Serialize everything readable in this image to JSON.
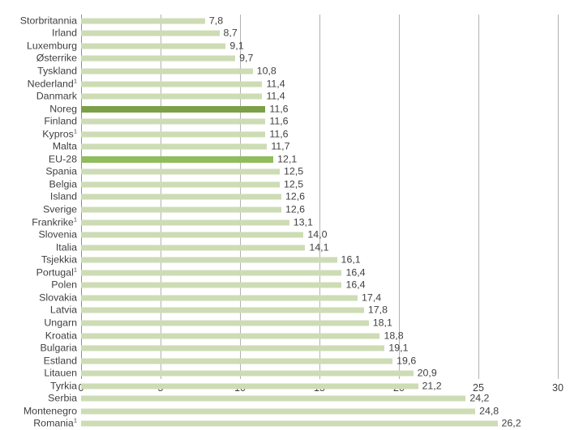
{
  "chart_data": {
    "type": "bar",
    "orientation": "horizontal",
    "title": "",
    "subtitle": "",
    "xlabel": "",
    "ylabel": "",
    "xlim": [
      0,
      30
    ],
    "xticks": [
      "0",
      "5",
      "10",
      "15",
      "20",
      "25",
      "30"
    ],
    "xtick_values": [
      0,
      5,
      10,
      15,
      20,
      25,
      30
    ],
    "grid": "vertical",
    "legend": "none",
    "value_label_format": "comma-decimal",
    "categories": [
      "Storbritannia",
      "Irland",
      "Luxemburg",
      "Østerrike",
      "Tyskland",
      "Nederland",
      "Danmark",
      "Noreg",
      "Finland",
      "Kypros",
      "Malta",
      "EU-28",
      "Spania",
      "Belgia",
      "Island",
      "Sverige",
      "Frankrike",
      "Slovenia",
      "Italia",
      "Tsjekkia",
      "Portugal",
      "Polen",
      "Slovakia",
      "Latvia",
      "Ungarn",
      "Kroatia",
      "Bulgaria",
      "Estland",
      "Litauen",
      "Tyrkia",
      "Serbia",
      "Montenegro",
      "Romania"
    ],
    "values": [
      7.8,
      8.7,
      9.1,
      9.7,
      10.8,
      11.4,
      11.4,
      11.6,
      11.6,
      11.6,
      11.7,
      12.1,
      12.5,
      12.5,
      12.6,
      12.6,
      13.1,
      14.0,
      14.1,
      16.1,
      16.4,
      16.4,
      17.4,
      17.8,
      18.1,
      18.8,
      19.1,
      19.6,
      20.9,
      21.2,
      24.2,
      24.8,
      26.2
    ],
    "value_labels": [
      "7,8",
      "8,7",
      "9,1",
      "9,7",
      "10,8",
      "11,4",
      "11,4",
      "11,6",
      "11,6",
      "11,6",
      "11,7",
      "12,1",
      "12,5",
      "12,5",
      "12,6",
      "12,6",
      "13,1",
      "14,0",
      "14,1",
      "16,1",
      "16,4",
      "16,4",
      "17,4",
      "17,8",
      "18,1",
      "18,8",
      "19,1",
      "19,6",
      "20,9",
      "21,2",
      "24,2",
      "24,8",
      "26,2"
    ],
    "category_footnotes": [
      "",
      "",
      "",
      "",
      "",
      "1",
      "",
      "",
      "",
      "1",
      "",
      "",
      "",
      "",
      "",
      "",
      "1",
      "",
      "",
      "",
      "1",
      "",
      "",
      "",
      "",
      "",
      "",
      "",
      "",
      "",
      "",
      "",
      "1"
    ],
    "highlights": {
      "Noreg": "primary",
      "EU-28": "secondary"
    },
    "colors": {
      "bar_default": "#cddcb4",
      "bar_highlight_primary": "#7ba047",
      "bar_highlight_secondary": "#8fbc5c",
      "gridline": "#b2b2b2",
      "axis": "#8c8c8c",
      "text": "#3f3f3f",
      "background": "#ffffff"
    }
  }
}
